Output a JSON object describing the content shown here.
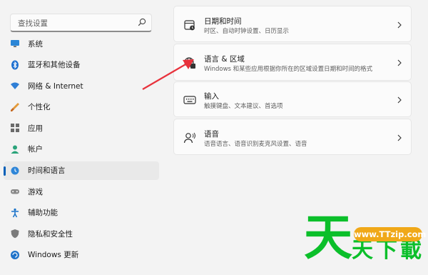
{
  "search": {
    "placeholder": "查找设置"
  },
  "sidebar": {
    "items": [
      {
        "label": "系统",
        "icon": "monitor-icon"
      },
      {
        "label": "蓝牙和其他设备",
        "icon": "bluetooth-icon"
      },
      {
        "label": "网络 & Internet",
        "icon": "wifi-icon"
      },
      {
        "label": "个性化",
        "icon": "brush-icon"
      },
      {
        "label": "应用",
        "icon": "apps-icon"
      },
      {
        "label": "帐户",
        "icon": "account-icon"
      },
      {
        "label": "时间和语言",
        "icon": "globe-clock-icon",
        "active": true
      },
      {
        "label": "游戏",
        "icon": "gamepad-icon"
      },
      {
        "label": "辅助功能",
        "icon": "accessibility-icon"
      },
      {
        "label": "隐私和安全性",
        "icon": "shield-icon"
      },
      {
        "label": "Windows 更新",
        "icon": "update-icon"
      }
    ]
  },
  "cards": [
    {
      "title": "日期和时间",
      "subtitle": "时区、自动时钟设置、日历显示",
      "icon": "calendar-clock-icon"
    },
    {
      "title": "语言 & 区域",
      "subtitle": "Windows 和某些应用根据你所在的区域设置日期和时间的格式",
      "icon": "language-globe-icon"
    },
    {
      "title": "输入",
      "subtitle": "触摸键盘、文本建议、首选项",
      "icon": "keyboard-icon"
    },
    {
      "title": "语音",
      "subtitle": "语音语言、语音识别麦克风设置、语音",
      "icon": "speech-icon"
    }
  ],
  "watermark": {
    "big_char": "天",
    "small_chars": [
      "天",
      "下",
      "載"
    ],
    "url": "www.TTzip.com"
  },
  "colors": {
    "accent": "#005fb8",
    "arrow": "#e8323c",
    "watermark_green": "#0bbf2a",
    "watermark_pill": "#f0a818"
  }
}
